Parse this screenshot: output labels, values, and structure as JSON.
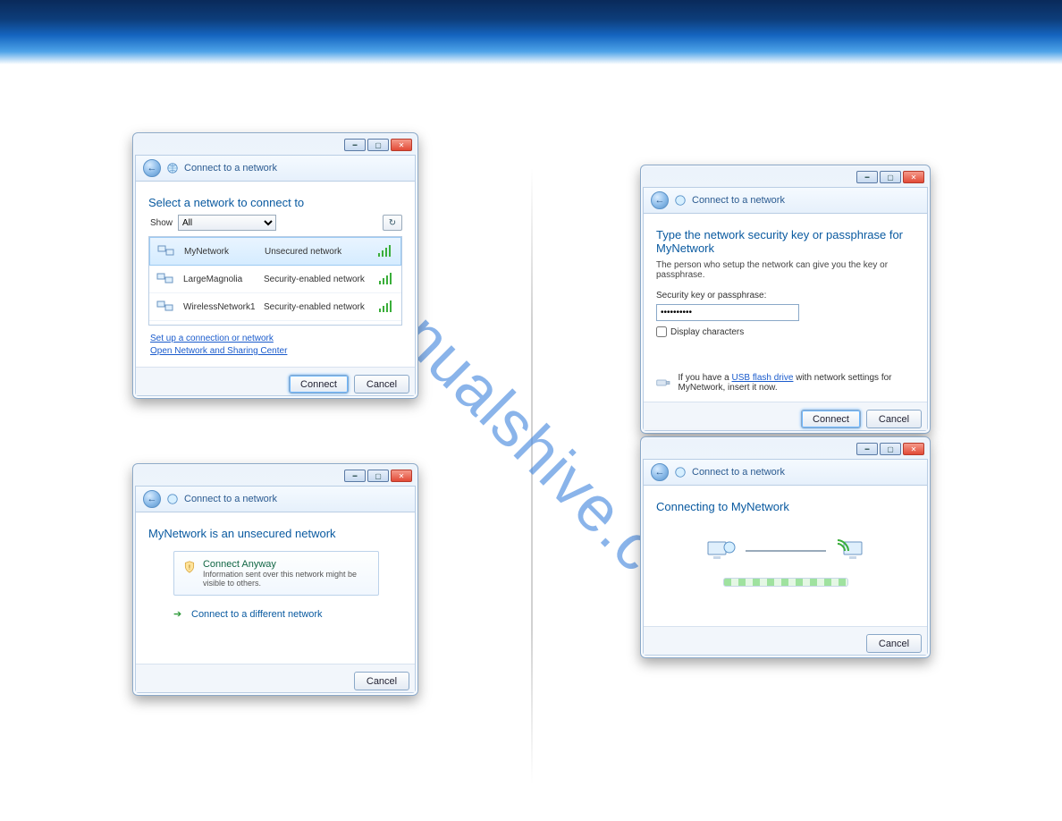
{
  "watermark": "manualshive.com",
  "common": {
    "title": "Connect to a network",
    "connect": "Connect",
    "cancel": "Cancel"
  },
  "dlg1": {
    "heading": "Select a network to connect to",
    "show_label": "Show",
    "show_value": "All",
    "networks": [
      {
        "name": "MyNetwork",
        "type": "Unsecured network"
      },
      {
        "name": "LargeMagnolia",
        "type": "Security-enabled network"
      },
      {
        "name": "WirelessNetwork1",
        "type": "Security-enabled network"
      }
    ],
    "links": {
      "setup": "Set up a connection or network",
      "open_center": "Open Network and Sharing Center"
    }
  },
  "dlg2": {
    "heading": "MyNetwork is an unsecured network",
    "opt_title": "Connect Anyway",
    "opt_desc": "Information sent over this network might be visible to others.",
    "alt": "Connect to a different network"
  },
  "dlg3": {
    "heading": "Type the network security key or passphrase for MyNetwork",
    "sub": "The person who setup the network can give you the key or passphrase.",
    "label": "Security key or passphrase:",
    "value": "••••••••••",
    "chk": "Display characters",
    "usb_pre": "If you have a",
    "usb_link": "USB flash drive",
    "usb_post": "with network settings for MyNetwork, insert it now."
  },
  "dlg4": {
    "heading": "Connecting to MyNetwork"
  }
}
